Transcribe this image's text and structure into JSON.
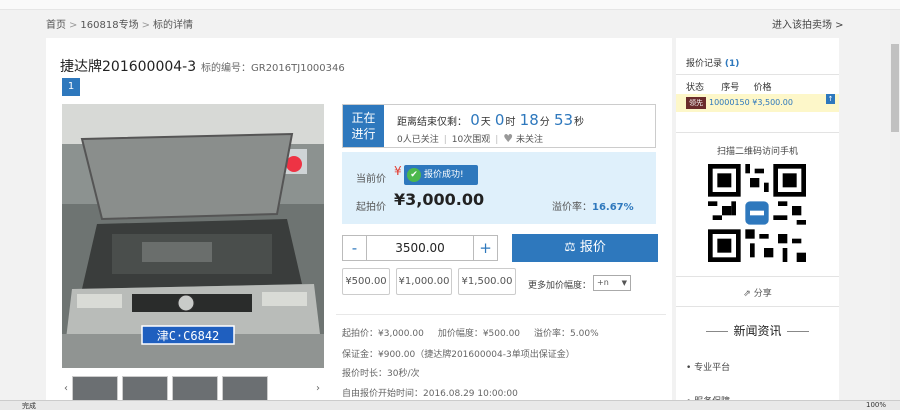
{
  "breadcrumb": {
    "home": "首页",
    "sep": ">",
    "session": "160818专场",
    "current": "标的详情"
  },
  "enter_session_link": "进入该拍卖场 >",
  "lot": {
    "title": "捷达牌201600004-3",
    "number_label": "标的编号：",
    "number": "GR2016TJ1000346",
    "page_indicator": "1"
  },
  "status": {
    "tag_line1": "正在",
    "tag_line2": "进行",
    "countdown_label": "距离结束仅剩：",
    "days": "0",
    "days_unit": "天",
    "hours": "0",
    "hours_unit": "时",
    "minutes": "18",
    "minutes_unit": "分",
    "seconds": "53",
    "seconds_unit": "秒",
    "watchers": "0人已关注",
    "views": "10次围观",
    "follow": "未关注"
  },
  "price": {
    "current_label": "当前价",
    "current_value": "¥",
    "toast": "报价成功!",
    "start_label": "起拍价",
    "start_value": "¥3,000.00",
    "premium_label": "溢价率：",
    "premium_value": "16.67%"
  },
  "bid": {
    "minus": "-",
    "amount": "3500.00",
    "plus": "+",
    "button": "报价",
    "increments": [
      "¥500.00",
      "¥1,000.00",
      "¥1,500.00"
    ],
    "more_label": "更多加价幅度：",
    "select_value": "+n"
  },
  "info": {
    "line1_a": "起拍价：¥3,000.00",
    "line1_b": "加价幅度：¥500.00",
    "line1_c": "溢价率：5.00%",
    "line2": "保证金：¥900.00（捷达牌201600004-3单项出保证金）",
    "line3": "报价时长：30秒/次",
    "line4": "自由报价开始时间：2016.08.29 10:00:00"
  },
  "side": {
    "record_title": "报价记录",
    "record_count": "(1)",
    "head_status": "状态",
    "head_no": "序号",
    "head_price": "价格",
    "row_tag": "领先",
    "row_text": "10000150  ¥3,500.00",
    "row_edge": "↑",
    "scan_text": "扫描二维码访问手机",
    "share": "分享",
    "news_title": "新闻资讯",
    "news_item1": "专业平台",
    "news_item2": "服务保障"
  },
  "statusbar": {
    "done": "完成",
    "zoom": "100%"
  }
}
